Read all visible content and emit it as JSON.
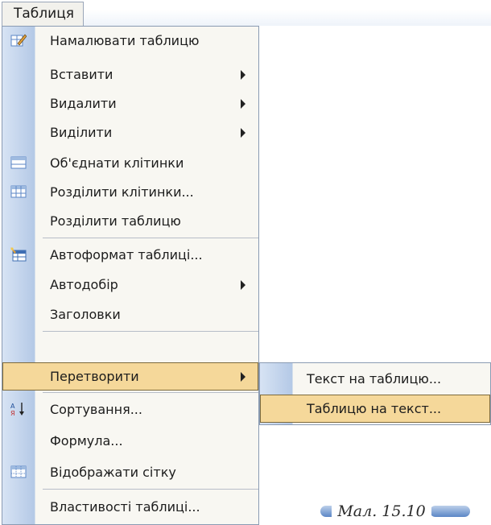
{
  "menubar": {
    "title": "Таблиця"
  },
  "menu": {
    "items": [
      {
        "label": "Намалювати таблицю",
        "icon": "pencil-table-icon"
      },
      {
        "label": "Вставити",
        "submenu": true
      },
      {
        "label": "Видалити",
        "submenu": true
      },
      {
        "label": "Виділити",
        "submenu": true
      },
      {
        "label": "Об'єднати клітинки",
        "icon": "merge-cells-icon"
      },
      {
        "label": "Розділити клітинки...",
        "icon": "split-cells-icon"
      },
      {
        "label": "Розділити таблицю"
      },
      {
        "label": "Автоформат таблиці...",
        "icon": "autoformat-icon"
      },
      {
        "label": "Автодобір",
        "submenu": true
      },
      {
        "label": "Заголовки"
      },
      {
        "label": "Перетворити",
        "submenu": true,
        "highlighted": true
      },
      {
        "label": "Сортування...",
        "icon": "sort-az-icon"
      },
      {
        "label": "Формула..."
      },
      {
        "label": "Відображати сітку",
        "icon": "grid-icon"
      },
      {
        "label": "Властивості таблиці..."
      }
    ]
  },
  "submenu": {
    "items": [
      {
        "label": "Текст на таблицю..."
      },
      {
        "label": "Таблицю на текст...",
        "highlighted": true
      }
    ]
  },
  "caption": "Мал. 15.10",
  "colors": {
    "highlight": "#f5d89a",
    "icon_blue": "#5b86c6"
  }
}
